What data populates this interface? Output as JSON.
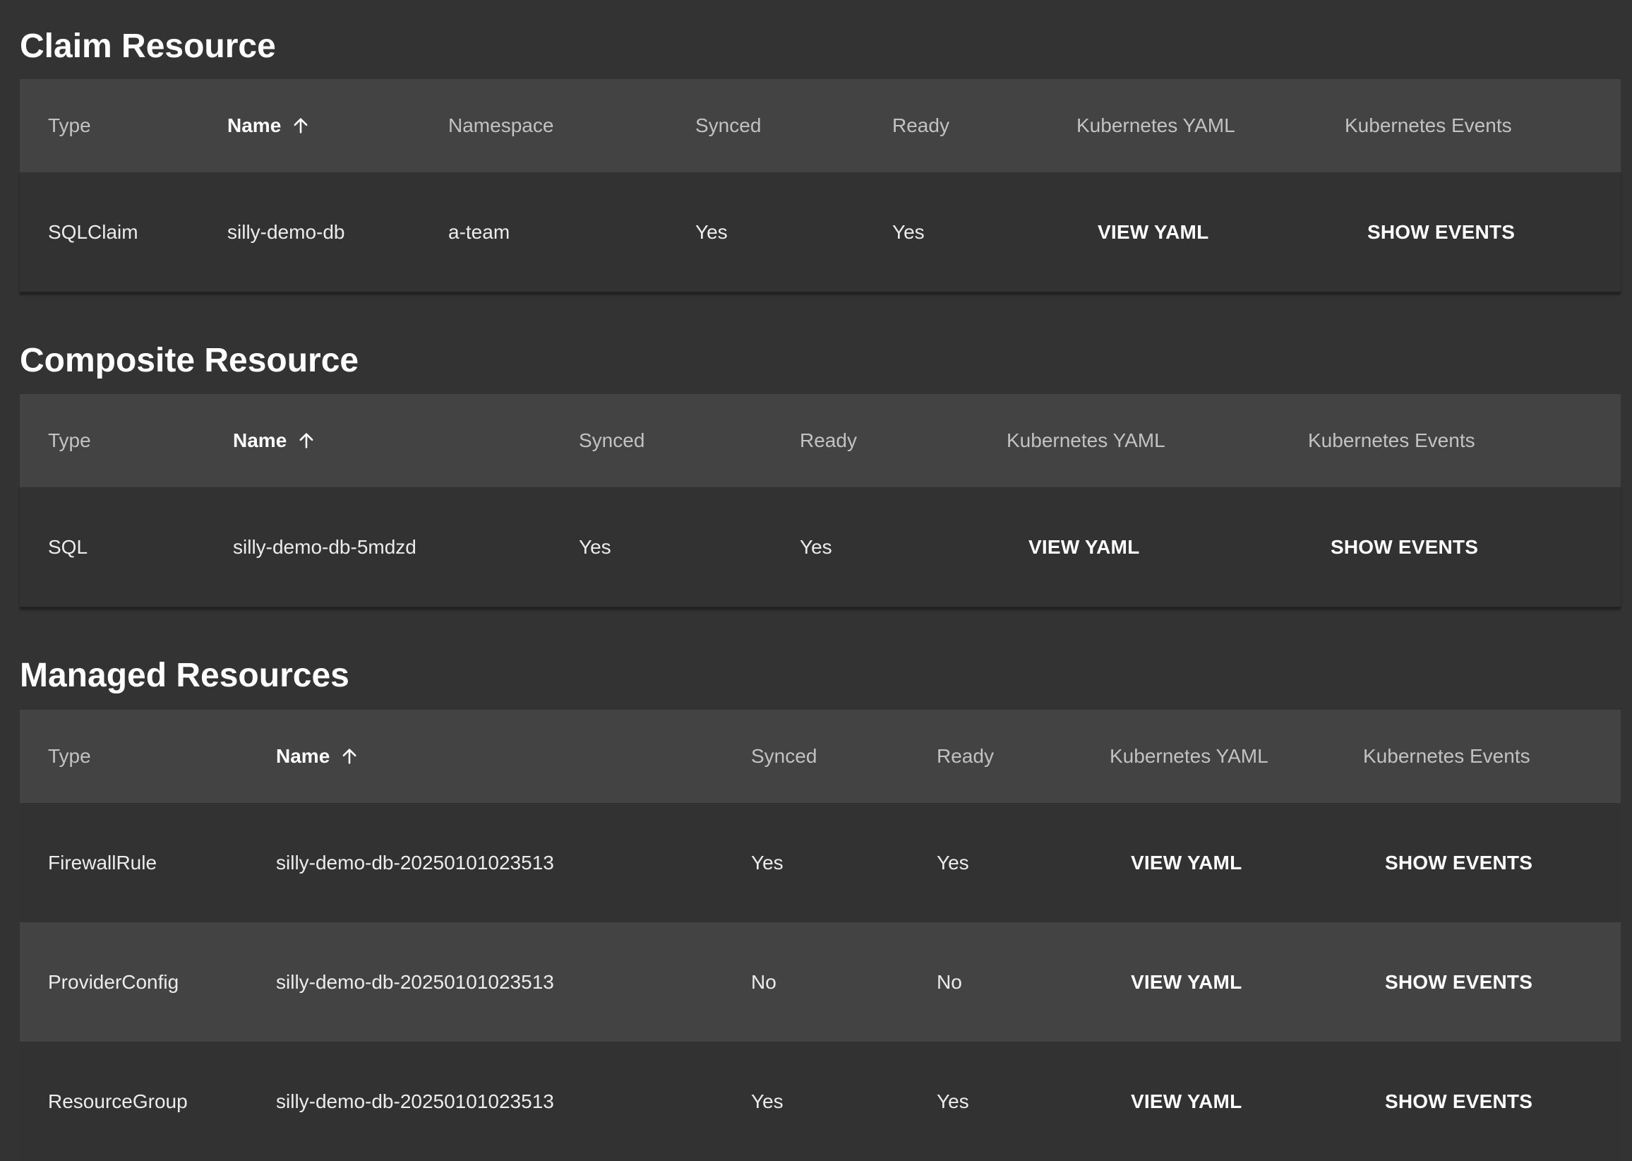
{
  "sections": {
    "claim": {
      "title": "Claim Resource",
      "headers": {
        "type": "Type",
        "name": "Name",
        "namespace": "Namespace",
        "synced": "Synced",
        "ready": "Ready",
        "yaml": "Kubernetes YAML",
        "events": "Kubernetes Events"
      },
      "rows": [
        {
          "type": "SQLClaim",
          "name": "silly-demo-db",
          "namespace": "a-team",
          "synced": "Yes",
          "ready": "Yes",
          "yaml_button": "VIEW YAML",
          "events_button": "SHOW EVENTS"
        }
      ]
    },
    "composite": {
      "title": "Composite Resource",
      "headers": {
        "type": "Type",
        "name": "Name",
        "synced": "Synced",
        "ready": "Ready",
        "yaml": "Kubernetes YAML",
        "events": "Kubernetes Events"
      },
      "rows": [
        {
          "type": "SQL",
          "name": "silly-demo-db-5mdzd",
          "synced": "Yes",
          "ready": "Yes",
          "yaml_button": "VIEW YAML",
          "events_button": "SHOW EVENTS"
        }
      ]
    },
    "managed": {
      "title": "Managed Resources",
      "headers": {
        "type": "Type",
        "name": "Name",
        "synced": "Synced",
        "ready": "Ready",
        "yaml": "Kubernetes YAML",
        "events": "Kubernetes Events"
      },
      "rows": [
        {
          "type": "FirewallRule",
          "name": "silly-demo-db-20250101023513",
          "synced": "Yes",
          "ready": "Yes",
          "yaml_button": "VIEW YAML",
          "events_button": "SHOW EVENTS"
        },
        {
          "type": "ProviderConfig",
          "name": "silly-demo-db-20250101023513",
          "synced": "No",
          "ready": "No",
          "yaml_button": "VIEW YAML",
          "events_button": "SHOW EVENTS"
        },
        {
          "type": "ResourceGroup",
          "name": "silly-demo-db-20250101023513",
          "synced": "Yes",
          "ready": "Yes",
          "yaml_button": "VIEW YAML",
          "events_button": "SHOW EVENTS"
        }
      ]
    }
  },
  "icons": {
    "sort": "arrow-up-icon"
  },
  "colors": {
    "background": "#333333",
    "header_row": "#434343",
    "row": "#323232",
    "row_alt": "#434343",
    "header_text": "#c2c2c2",
    "text": "#ffffff"
  }
}
